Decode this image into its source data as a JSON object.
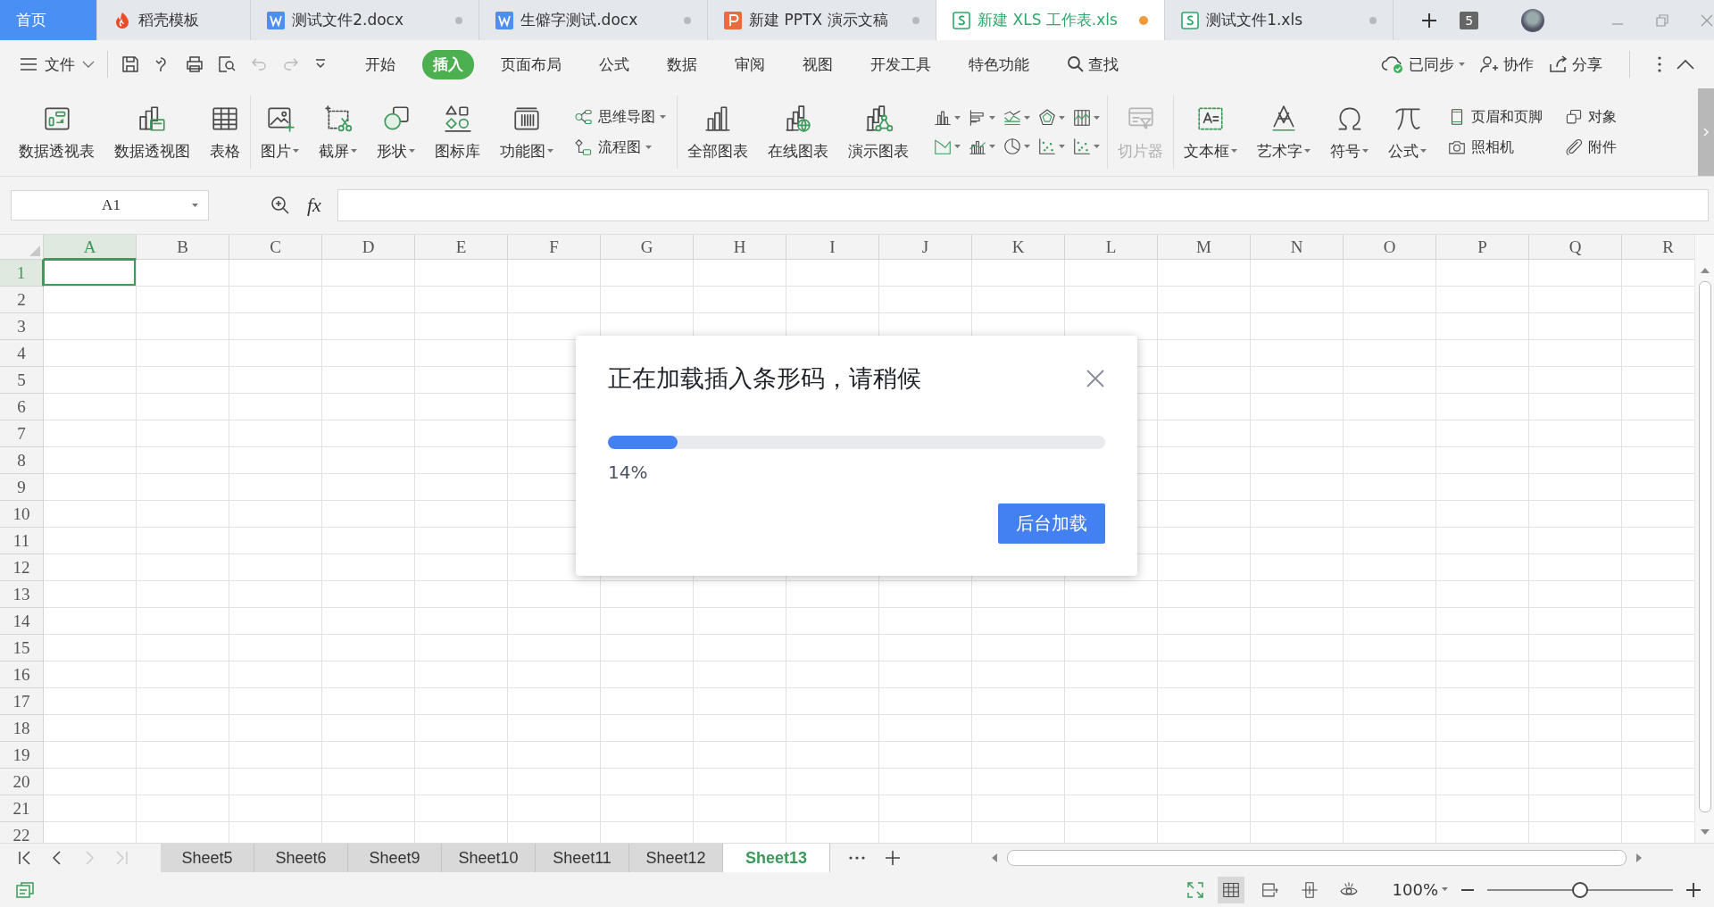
{
  "tabs": [
    {
      "label": "首页",
      "kind": "home",
      "selected": false
    },
    {
      "label": "稻壳模板",
      "kind": "docer",
      "selected": false
    },
    {
      "label": "测试文件2.docx",
      "kind": "writer",
      "selected": false,
      "unsaved": false
    },
    {
      "label": "生僻字测试.docx",
      "kind": "writer",
      "selected": false,
      "unsaved": false
    },
    {
      "label": "新建 PPTX 演示文稿",
      "kind": "presentation",
      "selected": false,
      "unsaved": false
    },
    {
      "label": "新建 XLS 工作表.xls",
      "kind": "spreadsheet",
      "selected": true,
      "unsaved": true
    },
    {
      "label": "测试文件1.xls",
      "kind": "spreadsheet",
      "selected": false,
      "unsaved": false
    }
  ],
  "window_count": "5",
  "file_menu": "文件",
  "menu_tabs": [
    {
      "label": "开始",
      "selected": false
    },
    {
      "label": "插入",
      "selected": true
    },
    {
      "label": "页面布局",
      "selected": false
    },
    {
      "label": "公式",
      "selected": false
    },
    {
      "label": "数据",
      "selected": false
    },
    {
      "label": "审阅",
      "selected": false
    },
    {
      "label": "视图",
      "selected": false
    },
    {
      "label": "开发工具",
      "selected": false
    },
    {
      "label": "特色功能",
      "selected": false
    }
  ],
  "search": "查找",
  "sync": "已同步",
  "collaborate": "协作",
  "share": "分享",
  "ribbon": [
    {
      "items": [
        {
          "kind": "large",
          "label": "数据透视表",
          "dropdown": false,
          "disabled": false
        },
        {
          "kind": "large",
          "label": "数据透视图",
          "dropdown": false,
          "disabled": false
        },
        {
          "kind": "large",
          "label": "表格",
          "dropdown": false,
          "disabled": false
        }
      ]
    },
    {
      "items": [
        {
          "kind": "large",
          "label": "图片",
          "dropdown": true,
          "disabled": false
        },
        {
          "kind": "large",
          "label": "截屏",
          "dropdown": true,
          "disabled": false
        },
        {
          "kind": "large",
          "label": "形状",
          "dropdown": true,
          "disabled": false
        },
        {
          "kind": "large",
          "label": "图标库",
          "dropdown": false,
          "disabled": false
        },
        {
          "kind": "large",
          "label": "功能图",
          "dropdown": true,
          "disabled": false
        },
        {
          "kind": "stack",
          "items": [
            {
              "label": "思维导图",
              "dropdown": true
            },
            {
              "label": "流程图",
              "dropdown": true
            }
          ]
        }
      ]
    },
    {
      "items": [
        {
          "kind": "large",
          "label": "全部图表",
          "dropdown": false,
          "disabled": false
        },
        {
          "kind": "large",
          "label": "在线图表",
          "dropdown": false,
          "disabled": false
        },
        {
          "kind": "large",
          "label": "演示图表",
          "dropdown": false,
          "disabled": false
        },
        {
          "kind": "chart-grid"
        }
      ]
    },
    {
      "items": [
        {
          "kind": "large",
          "label": "切片器",
          "dropdown": false,
          "disabled": true
        }
      ]
    },
    {
      "items": [
        {
          "kind": "large",
          "label": "文本框",
          "dropdown": true,
          "disabled": false
        },
        {
          "kind": "large",
          "label": "艺术字",
          "dropdown": true,
          "disabled": false
        },
        {
          "kind": "large",
          "label": "符号",
          "dropdown": true,
          "disabled": false
        },
        {
          "kind": "large",
          "label": "公式",
          "dropdown": true,
          "disabled": false
        },
        {
          "kind": "stack",
          "items": [
            {
              "label": "页眉和页脚",
              "dropdown": false
            },
            {
              "label": "照相机",
              "dropdown": false
            }
          ]
        },
        {
          "kind": "stack",
          "items": [
            {
              "label": "对象",
              "dropdown": false
            },
            {
              "label": "附件",
              "dropdown": false
            }
          ]
        }
      ]
    }
  ],
  "name_box": "A1",
  "formula_label": "fx",
  "columns": [
    {
      "label": "A",
      "selected": true
    },
    {
      "label": "B",
      "selected": false
    },
    {
      "label": "C",
      "selected": false
    },
    {
      "label": "D",
      "selected": false
    },
    {
      "label": "E",
      "selected": false
    },
    {
      "label": "F",
      "selected": false
    },
    {
      "label": "G",
      "selected": false
    },
    {
      "label": "H",
      "selected": false
    },
    {
      "label": "I",
      "selected": false
    },
    {
      "label": "J",
      "selected": false
    },
    {
      "label": "K",
      "selected": false
    },
    {
      "label": "L",
      "selected": false
    },
    {
      "label": "M",
      "selected": false
    },
    {
      "label": "N",
      "selected": false
    },
    {
      "label": "O",
      "selected": false
    },
    {
      "label": "P",
      "selected": false
    },
    {
      "label": "Q",
      "selected": false
    },
    {
      "label": "R",
      "selected": false
    }
  ],
  "rows": [
    {
      "label": "1",
      "selected": true
    },
    {
      "label": "2",
      "selected": false
    },
    {
      "label": "3",
      "selected": false
    },
    {
      "label": "4",
      "selected": false
    },
    {
      "label": "5",
      "selected": false
    },
    {
      "label": "6",
      "selected": false
    },
    {
      "label": "7",
      "selected": false
    },
    {
      "label": "8",
      "selected": false
    },
    {
      "label": "9",
      "selected": false
    },
    {
      "label": "10",
      "selected": false
    },
    {
      "label": "11",
      "selected": false
    },
    {
      "label": "12",
      "selected": false
    },
    {
      "label": "13",
      "selected": false
    },
    {
      "label": "14",
      "selected": false
    },
    {
      "label": "15",
      "selected": false
    },
    {
      "label": "16",
      "selected": false
    },
    {
      "label": "17",
      "selected": false
    },
    {
      "label": "18",
      "selected": false
    },
    {
      "label": "19",
      "selected": false
    },
    {
      "label": "20",
      "selected": false
    },
    {
      "label": "21",
      "selected": false
    },
    {
      "label": "22",
      "selected": false
    }
  ],
  "sheets": [
    {
      "label": "Sheet5",
      "selected": false
    },
    {
      "label": "Sheet6",
      "selected": false
    },
    {
      "label": "Sheet9",
      "selected": false
    },
    {
      "label": "Sheet10",
      "selected": false
    },
    {
      "label": "Sheet11",
      "selected": false
    },
    {
      "label": "Sheet12",
      "selected": false
    },
    {
      "label": "Sheet13",
      "selected": true
    }
  ],
  "dialog": {
    "title": "正在加载插入条形码，请稍候",
    "progress": {
      "level": 0.14
    },
    "reading": "14%",
    "button": "后台加载"
  },
  "status_bar": {
    "view_modes": [
      {
        "selected": true
      },
      {
        "selected": false
      },
      {
        "selected": false
      },
      {
        "selected": false
      }
    ],
    "zoom": "100%",
    "zoom_slider": {
      "level": 0.5
    }
  }
}
